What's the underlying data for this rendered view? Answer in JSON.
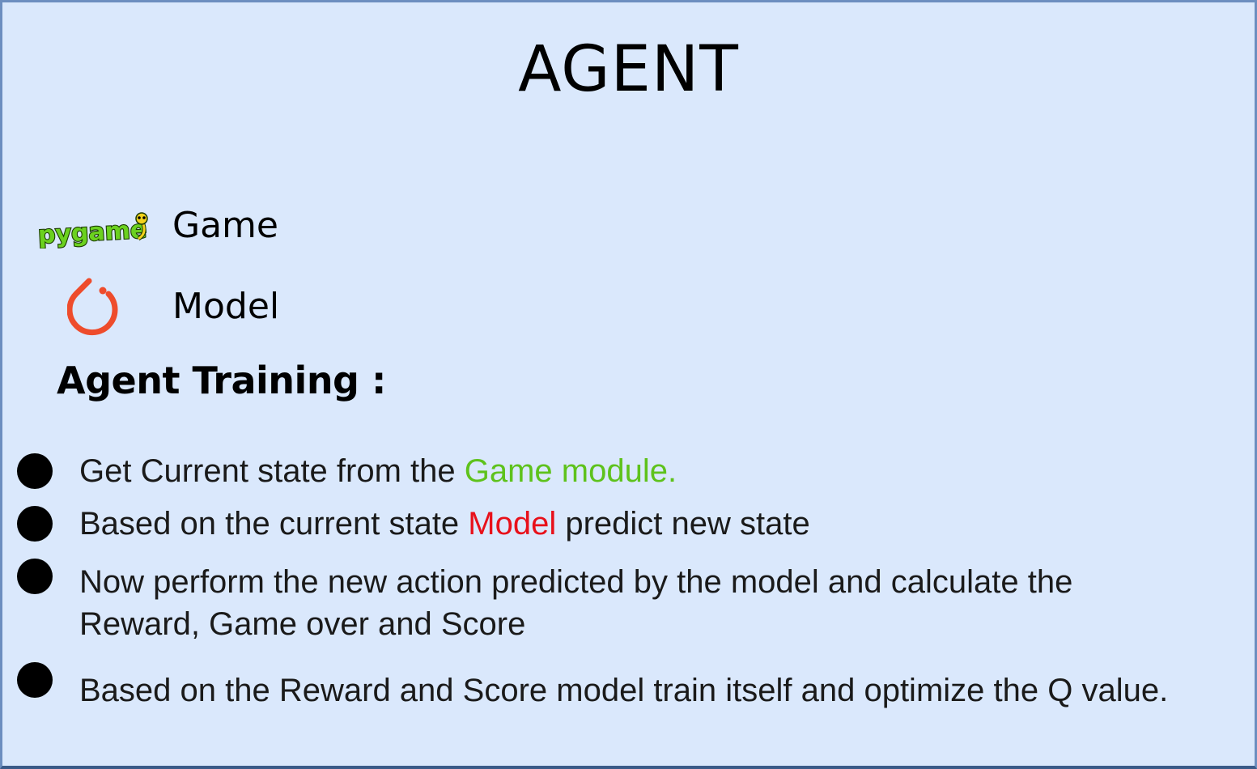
{
  "title": "AGENT",
  "legend": {
    "game": {
      "label": "Game",
      "logo_text": "pygame",
      "icon": "pygame-logo"
    },
    "model": {
      "label": "Model",
      "icon": "pytorch-icon"
    }
  },
  "section_title": "Agent Training :",
  "steps": [
    {
      "before": "Get Current state from the ",
      "highlight": "Game module.",
      "after": ""
    },
    {
      "before": "Based on the current state ",
      "highlight": "Model",
      "after": " predict new state"
    },
    {
      "line1": "Now perform the new action predicted by the model and calculate the",
      "line2": "Reward, Game over and Score"
    },
    {
      "text": "Based on the Reward and Score model train itself and optimize the Q value."
    }
  ],
  "colors": {
    "background": "#dae8fc",
    "border": "#6c8ebf",
    "highlight_game": "#5ec21c",
    "highlight_model": "#e8101a",
    "pytorch": "#ee4c2c"
  }
}
